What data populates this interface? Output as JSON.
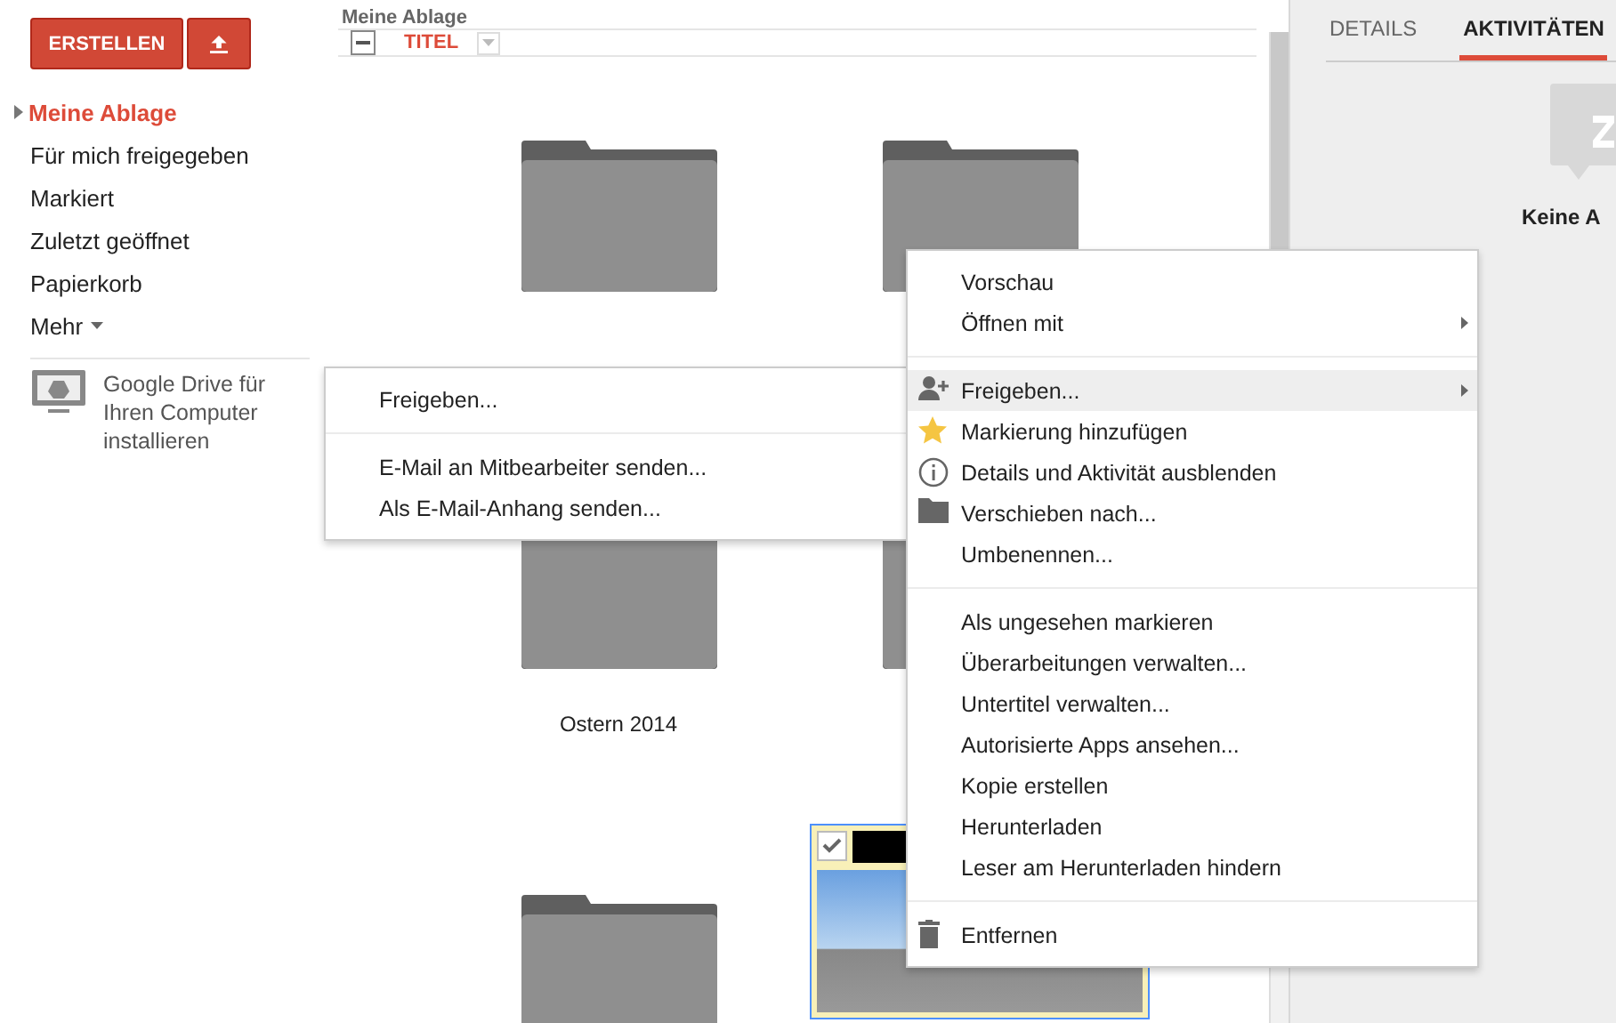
{
  "sidebar": {
    "create_button": "ERSTELLEN",
    "nav": [
      {
        "label": "Meine Ablage",
        "selected": true,
        "kind": "link"
      },
      {
        "label": "Für mich freigegeben",
        "selected": false,
        "kind": "link"
      },
      {
        "label": "Markiert",
        "selected": false,
        "kind": "link"
      },
      {
        "label": "Zuletzt geöffnet",
        "selected": false,
        "kind": "link"
      },
      {
        "label": "Papierkorb",
        "selected": false,
        "kind": "link"
      },
      {
        "label": "Mehr",
        "selected": false,
        "kind": "more"
      }
    ],
    "promo": "Google Drive für Ihren Computer installieren"
  },
  "main": {
    "breadcrumb": "Meine Ablage",
    "select_all_partial": true,
    "column": "TITEL",
    "items": [
      {
        "kind": "folder"
      },
      {
        "kind": "folder"
      },
      {
        "kind": "folder",
        "name": "Ostern 2014"
      },
      {
        "kind": "folder"
      },
      {
        "kind": "folder"
      },
      {
        "kind": "photo",
        "checked": true
      }
    ]
  },
  "details": {
    "tabs": [
      {
        "label": "DETAILS",
        "selected": false
      },
      {
        "label": "AKTIVITÄTEN",
        "selected": true
      }
    ],
    "empty_text": "Keine A"
  },
  "share_submenu": [
    [
      "Freigeben..."
    ],
    [
      "E-Mail an Mitbearbeiter senden...",
      "Als E-Mail-Anhang senden..."
    ]
  ],
  "context_menu": [
    [
      {
        "label": "Vorschau",
        "kind": "plain",
        "submenu": false,
        "highlighted": false
      },
      {
        "label": "Öffnen mit",
        "kind": "plain",
        "submenu": true,
        "highlighted": false
      }
    ],
    [
      {
        "label": "Freigeben...",
        "kind": "share",
        "submenu": true,
        "highlighted": true
      },
      {
        "label": "Markierung hinzufügen",
        "kind": "star",
        "submenu": false,
        "highlighted": false
      },
      {
        "label": "Details und Aktivität ausblenden",
        "kind": "info",
        "submenu": false,
        "highlighted": false
      },
      {
        "label": "Verschieben nach...",
        "kind": "move",
        "submenu": false,
        "highlighted": false
      },
      {
        "label": "Umbenennen...",
        "kind": "plain",
        "submenu": false,
        "highlighted": false
      }
    ],
    [
      {
        "label": "Als ungesehen markieren",
        "kind": "plain",
        "submenu": false,
        "highlighted": false
      },
      {
        "label": "Überarbeitungen verwalten...",
        "kind": "plain",
        "submenu": false,
        "highlighted": false
      },
      {
        "label": "Untertitel verwalten...",
        "kind": "plain",
        "submenu": false,
        "highlighted": false
      },
      {
        "label": "Autorisierte Apps ansehen...",
        "kind": "plain",
        "submenu": false,
        "highlighted": false
      },
      {
        "label": "Kopie erstellen",
        "kind": "plain",
        "submenu": false,
        "highlighted": false
      },
      {
        "label": "Herunterladen",
        "kind": "plain",
        "submenu": false,
        "highlighted": false
      },
      {
        "label": "Leser am Herunterladen hindern",
        "kind": "plain",
        "submenu": false,
        "highlighted": false
      }
    ],
    [
      {
        "label": "Entfernen",
        "kind": "delete",
        "submenu": false,
        "highlighted": false
      }
    ]
  ]
}
